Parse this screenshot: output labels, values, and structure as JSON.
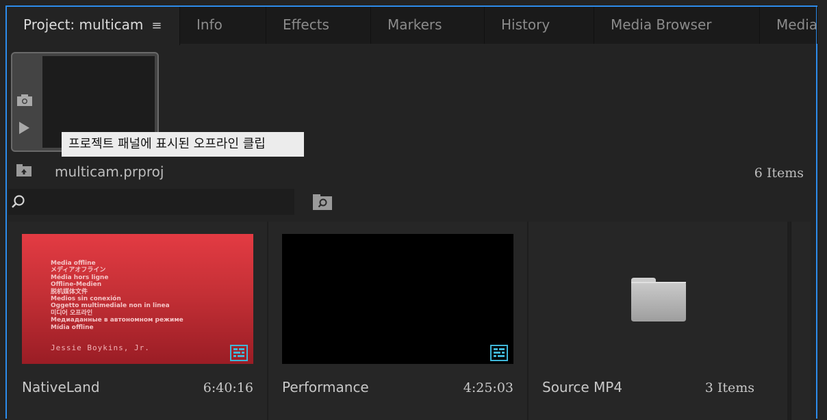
{
  "tabs": [
    {
      "label": "Project: multicam",
      "active": true
    },
    {
      "label": "Info"
    },
    {
      "label": "Effects"
    },
    {
      "label": "Markers"
    },
    {
      "label": "History"
    },
    {
      "label": "Media Browser"
    },
    {
      "label": "Media"
    }
  ],
  "panel_menu_glyph": "≡",
  "tooltip": "프로젝트 패널에 표시된 오프라인 클립",
  "project": {
    "file_name": "multicam.prproj",
    "item_count": "6 Items"
  },
  "search": {
    "value": "",
    "placeholder": ""
  },
  "offline_text_lines": [
    "Media offline",
    "メディアオフライン",
    "Média hors ligne",
    "Offline-Medien",
    "脱机媒体文件",
    "Medios sin conexión",
    "Oggetto multimediale non in linea",
    "미디어 오프라인",
    "Медиаданные в автономном режиме",
    "Mídia offline"
  ],
  "items": [
    {
      "name": "NativeLand",
      "meta": "6:40:16",
      "type": "sequence",
      "thumbnail": "offline",
      "owner": "Jessie Boykins, Jr."
    },
    {
      "name": "Performance",
      "meta": "4:25:03",
      "type": "sequence",
      "thumbnail": "black"
    },
    {
      "name": "Source MP4",
      "meta": "3 Items",
      "type": "bin"
    }
  ],
  "colors": {
    "accent": "#2d8ceb",
    "seq_icon": "#3fb6d8",
    "offline_red": "#d9363e"
  }
}
